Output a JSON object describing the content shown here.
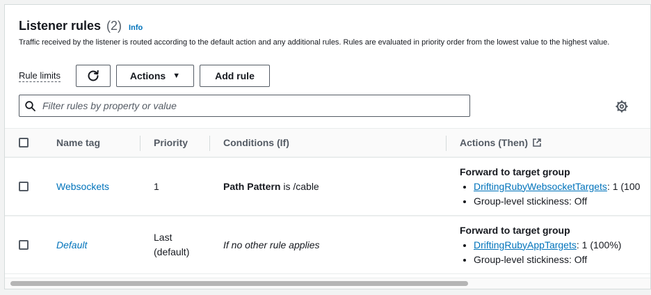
{
  "header": {
    "title": "Listener rules",
    "count": "(2)",
    "info_label": "Info",
    "description": "Traffic received by the listener is routed according to the default action and any additional rules. Rules are evaluated in priority order from the lowest value to the highest value."
  },
  "toolbar": {
    "rule_limits_label": "Rule limits",
    "actions_label": "Actions",
    "add_rule_label": "Add rule"
  },
  "filter": {
    "placeholder": "Filter rules by property or value"
  },
  "table": {
    "columns": {
      "name_tag": "Name tag",
      "priority": "Priority",
      "conditions": "Conditions (If)",
      "actions": "Actions (Then)"
    },
    "rows": [
      {
        "name": "Websockets",
        "priority_line1": "1",
        "priority_line2": "",
        "condition_bold": "Path Pattern",
        "condition_rest": " is /cable",
        "action_title": "Forward to target group",
        "target_group": "DriftingRubyWebsocketTargets",
        "target_weight": ": 1 (100",
        "stickiness": "Group-level stickiness: Off"
      },
      {
        "name": "Default",
        "priority_line1": "Last",
        "priority_line2": "(default)",
        "condition_italic": "If no other rule applies",
        "action_title": "Forward to target group",
        "target_group": "DriftingRubyAppTargets",
        "target_weight": ": 1 (100%)",
        "stickiness": "Group-level stickiness: Off"
      }
    ]
  },
  "icons": {
    "refresh": "refresh-icon",
    "caret": "caret-down-icon",
    "search": "search-icon",
    "settings": "gear-icon",
    "external": "external-link-icon"
  },
  "colors": {
    "link": "#0073bb",
    "text": "#16191f",
    "muted": "#545b64",
    "border": "#eaeded"
  }
}
